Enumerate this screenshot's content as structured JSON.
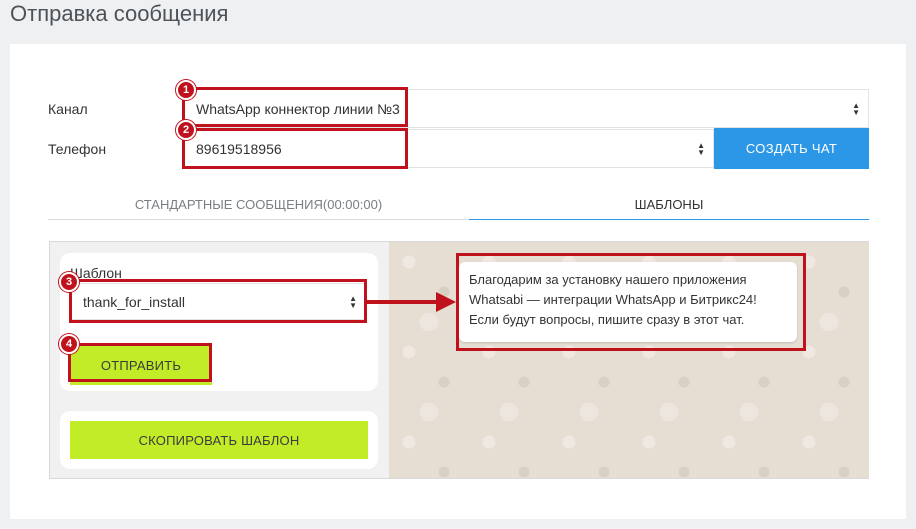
{
  "page_title": "Отправка сообщения",
  "form": {
    "channel_label": "Канал",
    "channel_value": "WhatsApp коннектор линии №3",
    "phone_label": "Телефон",
    "phone_value": "89619518956",
    "create_chat_button": "СОЗДАТЬ ЧАТ"
  },
  "tabs": [
    {
      "label": "СТАНДАРТНЫЕ СООБЩЕНИЯ(00:00:00)",
      "active": false
    },
    {
      "label": "ШАБЛОНЫ",
      "active": true
    }
  ],
  "template_panel": {
    "template_label": "Шаблон",
    "template_value": "thank_for_install",
    "send_button": "ОТПРАВИТЬ",
    "copy_button": "СКОПИРОВАТЬ ШАБЛОН"
  },
  "preview": {
    "message": "Благодарим за установку нашего приложения\nWhatsabi — интеграции WhatsApp и Битрикс24!\nЕсли будут вопросы, пишите сразу в этот чат."
  },
  "annotations": {
    "markers": [
      "1",
      "2",
      "3",
      "4"
    ],
    "highlight_color": "#c0121c"
  },
  "colors": {
    "accent_blue": "#2c97e6",
    "accent_green": "#c2ec27"
  }
}
